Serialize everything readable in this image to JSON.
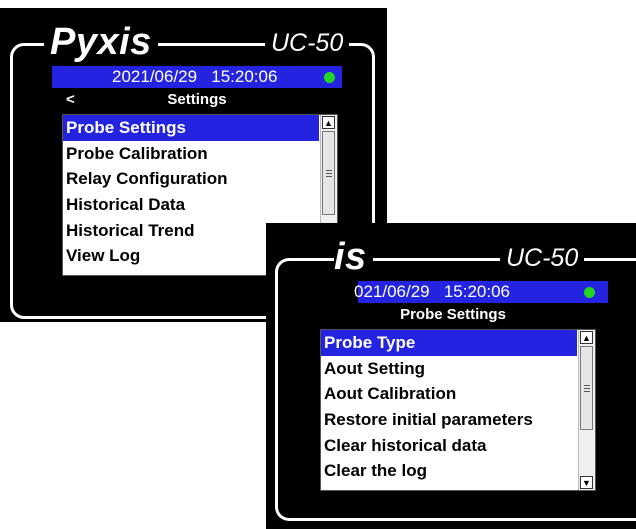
{
  "screens": [
    {
      "brand": "Pyxis",
      "model": "UC-50",
      "date": "2021/06/29",
      "time": "15:20:06",
      "back": "<",
      "title": "Settings",
      "items": [
        "Probe Settings",
        "Probe Calibration",
        "Relay Configuration",
        "Historical Data",
        "Historical Trend",
        "View Log"
      ],
      "selected_index": 0
    },
    {
      "brand": "is",
      "model": "UC-50",
      "date": "021/06/29",
      "time": "15:20:06",
      "title": "Probe Settings",
      "items": [
        "Probe Type",
        "Aout Setting",
        "Aout Calibration",
        "Restore initial parameters",
        "Clear historical data",
        "Clear the log"
      ],
      "selected_index": 0
    }
  ],
  "colors": {
    "bezel": "#000000",
    "status_bar": "#2424e0",
    "selection": "#2424e0",
    "status_dot": "#22d622"
  },
  "icons": {
    "status": "green-dot-icon",
    "scroll_up": "up-arrow-icon",
    "scroll_down": "down-arrow-icon"
  }
}
